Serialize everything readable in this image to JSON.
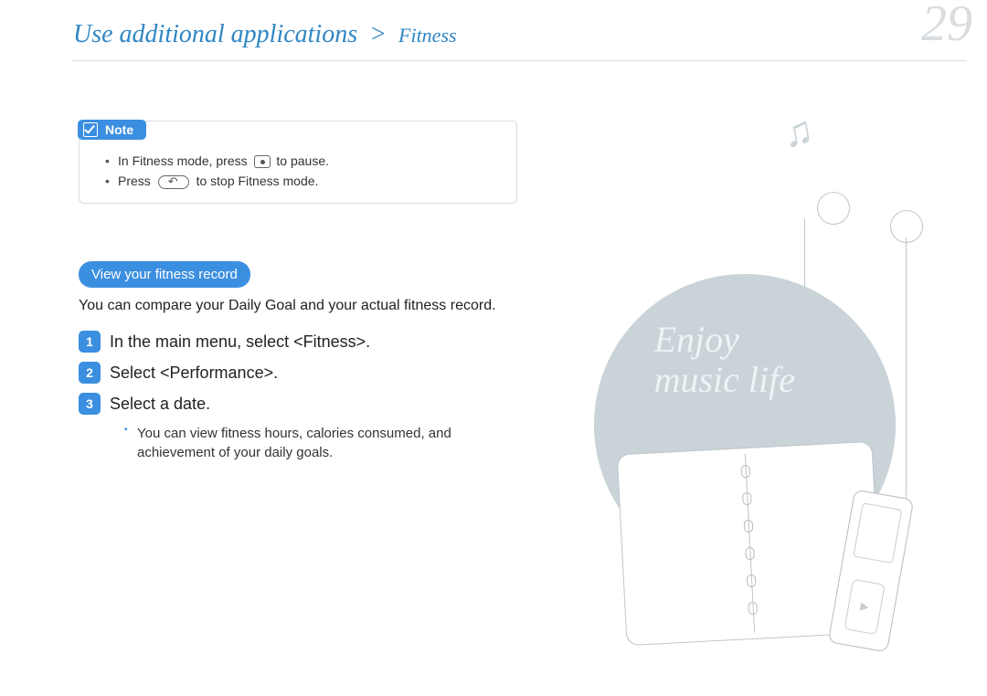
{
  "header": {
    "breadcrumb_main": "Use additional applications",
    "breadcrumb_sep": ">",
    "breadcrumb_sub": "Fitness",
    "page_number": "29"
  },
  "note": {
    "label": "Note",
    "items": [
      {
        "pre": "In Fitness mode, press ",
        "icon": "dot-button",
        "post": " to pause."
      },
      {
        "pre": "Press ",
        "icon": "back-button",
        "post": " to stop Fitness mode."
      }
    ]
  },
  "section": {
    "title": "View your fitness record",
    "intro": "You can compare your Daily Goal and your actual fitness record."
  },
  "steps": [
    {
      "n": "1",
      "text": "In the main menu, select <Fitness>."
    },
    {
      "n": "2",
      "text": "Select <Performance>."
    },
    {
      "n": "3",
      "text": "Select a date."
    }
  ],
  "step3_sub": "You can view fitness hours, calories consumed, and achievement of your daily goals.",
  "art": {
    "tagline_line1": "Enjoy",
    "tagline_line2": "music life",
    "music_glyph": "♫"
  }
}
